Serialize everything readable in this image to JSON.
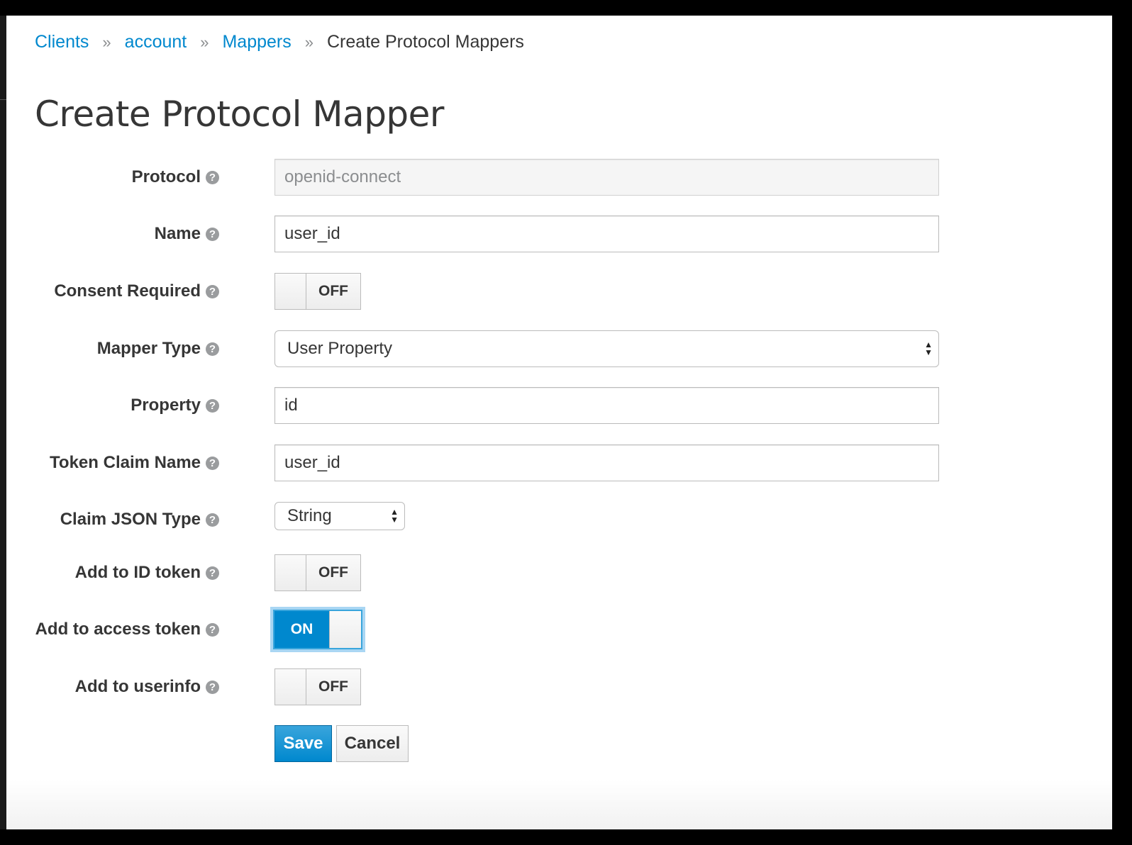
{
  "breadcrumb": {
    "items": [
      "Clients",
      "account",
      "Mappers"
    ],
    "separator": "»",
    "current": "Create Protocol Mappers"
  },
  "page_title": "Create Protocol Mapper",
  "help_glyph": "?",
  "form": {
    "protocol": {
      "label": "Protocol",
      "value": "openid-connect"
    },
    "name": {
      "label": "Name",
      "value": "user_id"
    },
    "consent_required": {
      "label": "Consent Required",
      "state": "OFF"
    },
    "mapper_type": {
      "label": "Mapper Type",
      "value": "User Property"
    },
    "property": {
      "label": "Property",
      "value": "id"
    },
    "token_claim_name": {
      "label": "Token Claim Name",
      "value": "user_id"
    },
    "claim_json_type": {
      "label": "Claim JSON Type",
      "value": "String"
    },
    "add_to_id_token": {
      "label": "Add to ID token",
      "state": "OFF"
    },
    "add_to_access_token": {
      "label": "Add to access token",
      "state": "ON"
    },
    "add_to_userinfo": {
      "label": "Add to userinfo",
      "state": "OFF"
    }
  },
  "actions": {
    "save": "Save",
    "cancel": "Cancel"
  },
  "colors": {
    "link": "#0088ce",
    "primary": "#0088ce",
    "focus_ring": "#a9d6f3",
    "text": "#363636"
  }
}
